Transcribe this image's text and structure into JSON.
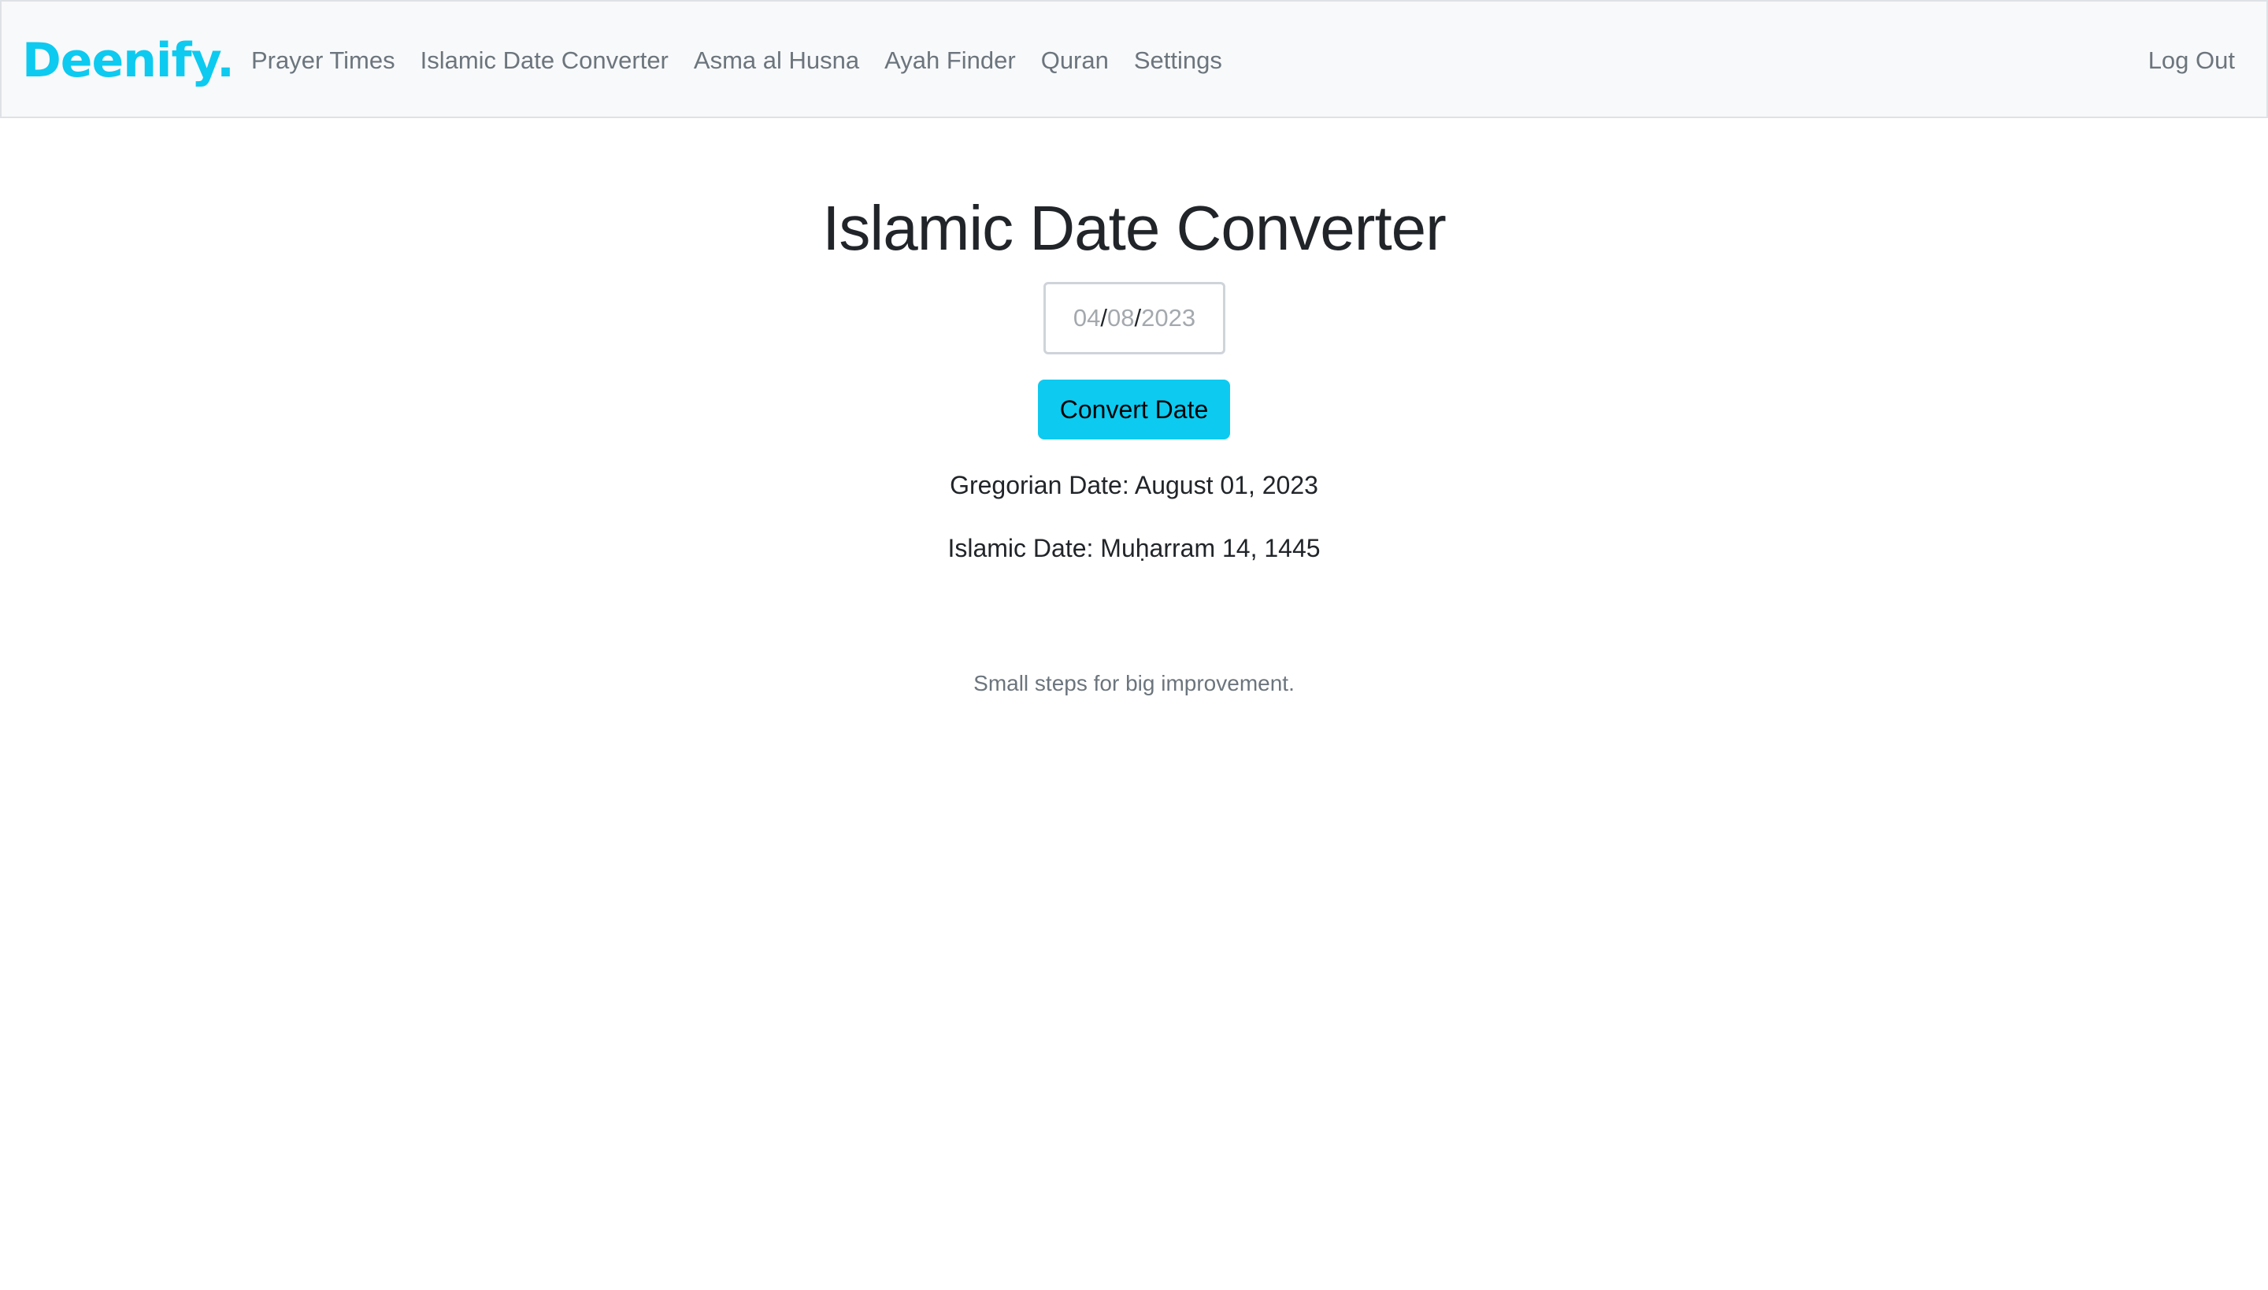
{
  "navbar": {
    "brand": "Deenify.",
    "links": [
      {
        "label": "Prayer Times"
      },
      {
        "label": "Islamic Date Converter"
      },
      {
        "label": "Asma al Husna"
      },
      {
        "label": "Ayah Finder"
      },
      {
        "label": "Quran"
      },
      {
        "label": "Settings"
      }
    ],
    "logout_label": "Log Out"
  },
  "main": {
    "title": "Islamic Date Converter",
    "date_input": {
      "day": "04",
      "month": "08",
      "year": "2023",
      "separator": "/"
    },
    "convert_label": "Convert Date",
    "gregorian_result": "Gregorian Date: August 01, 2023",
    "islamic_result": "Islamic Date: Muḥarram 14, 1445",
    "tagline": "Small steps for big improvement."
  },
  "colors": {
    "accent": "#0dcaf0",
    "nav_bg": "#f8f9fa",
    "muted_text": "#6c757d",
    "body_text": "#212529"
  }
}
